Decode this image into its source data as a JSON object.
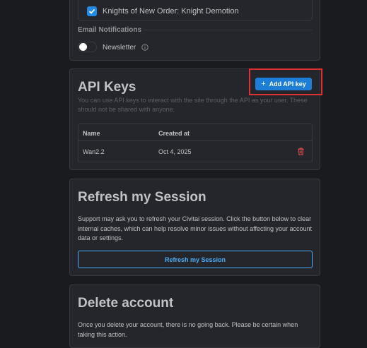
{
  "notifications": {
    "checkbox_label": "Knights of New Order: Knight Demotion",
    "checkbox_checked": true,
    "email_section_label": "Email Notifications",
    "newsletter_label": "Newsletter",
    "newsletter_enabled": false
  },
  "api_keys": {
    "title": "API Keys",
    "description": "You can use API keys to interact with the site through the API as your user. These should not be shared with anyone.",
    "add_button_label": "Add API key",
    "columns": [
      "Name",
      "Created at"
    ],
    "rows": [
      {
        "name": "Wan2.2",
        "created_at": "Oct 4, 2025"
      }
    ]
  },
  "refresh": {
    "title": "Refresh my Session",
    "description": "Support may ask you to refresh your Civitai session. Click the button below to clear internal caches, which can help resolve minor issues without affecting your account data or settings.",
    "button_label": "Refresh my Session"
  },
  "delete_account": {
    "title": "Delete account",
    "description": "Once you delete your account, there is no going back. Please be certain when taking this action."
  },
  "colors": {
    "accent": "#1c7ed6",
    "highlight": "#e03131",
    "danger": "#fa5252",
    "background": "#1a1b1e",
    "card": "#25262b"
  }
}
